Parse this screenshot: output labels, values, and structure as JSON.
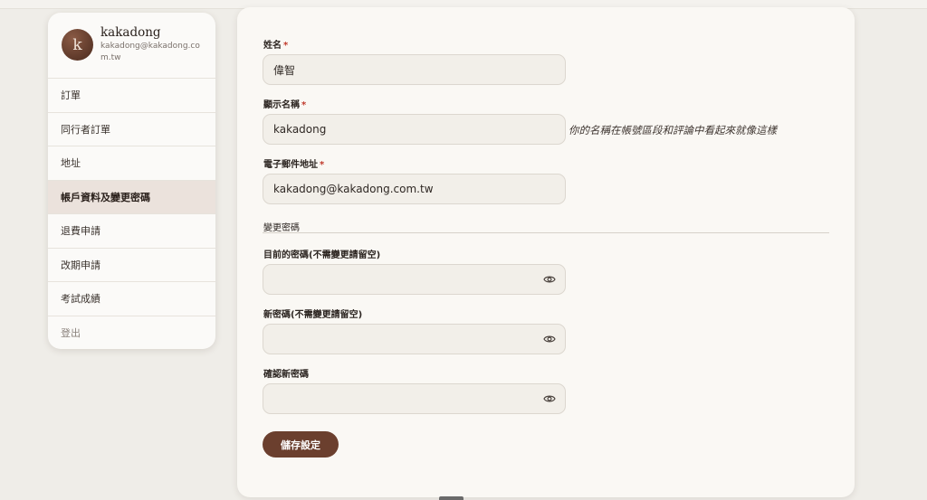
{
  "profile": {
    "avatar_letter": "k",
    "name": "kakadong",
    "email": "kakadong@kakadong.com.tw"
  },
  "sidebar": {
    "items": [
      {
        "label": "訂單"
      },
      {
        "label": "同行者訂單"
      },
      {
        "label": "地址"
      },
      {
        "label": "帳戶資料及變更密碼",
        "active": true
      },
      {
        "label": "退費申請"
      },
      {
        "label": "改期申請"
      },
      {
        "label": "考試成績"
      },
      {
        "label": "登出"
      }
    ]
  },
  "form": {
    "first_name": {
      "label": "姓名",
      "required_mark": "*",
      "value": "偉智"
    },
    "display_name": {
      "label": "顯示名稱",
      "required_mark": "*",
      "value": "kakadong",
      "hint": "你的名稱在帳號區段和評論中看起來就像這樣"
    },
    "email": {
      "label": "電子郵件地址",
      "required_mark": "*",
      "value": "kakadong@kakadong.com.tw"
    },
    "password_section_title": "變更密碼",
    "current_password": {
      "label": "目前的密碼(不需變更請留空)",
      "value": ""
    },
    "new_password": {
      "label": "新密碼(不需變更請留空)",
      "value": ""
    },
    "confirm_password": {
      "label": "確認新密碼",
      "value": ""
    },
    "save_label": "儲存設定"
  },
  "colors": {
    "accent": "#6b3f2e",
    "active_menu_bg": "#ebe2dc",
    "required": "#c0392b",
    "page_bg": "#efede8",
    "card_bg": "#faf8f4"
  },
  "icons": {
    "avatar": "avatar",
    "password_toggle": "eye-icon"
  }
}
